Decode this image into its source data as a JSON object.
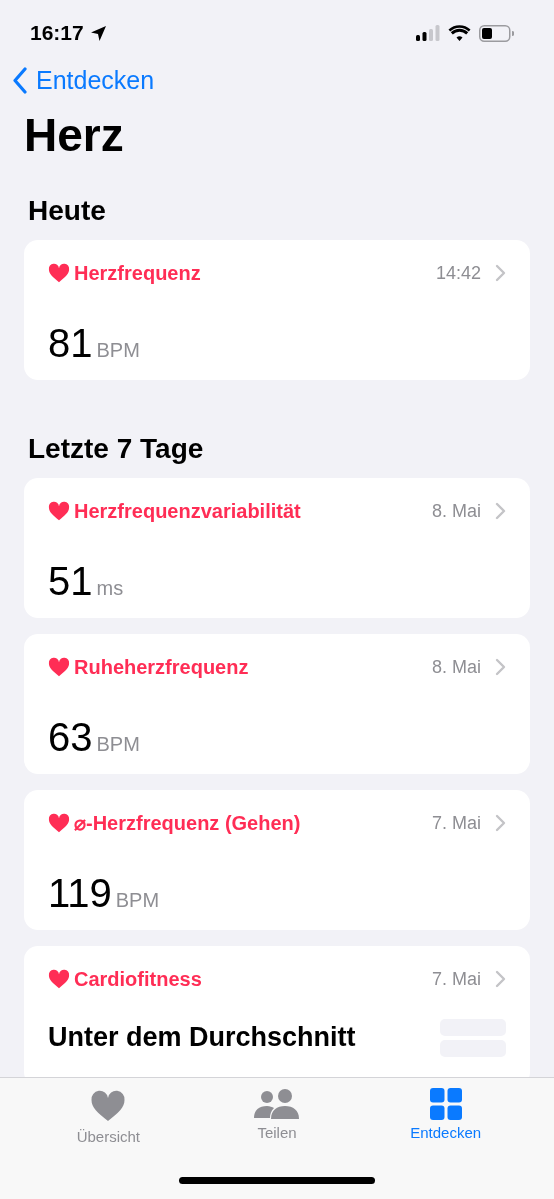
{
  "status_bar": {
    "time": "16:17"
  },
  "nav": {
    "back": "Entdecken"
  },
  "title": "Herz",
  "sections": [
    {
      "title": "Heute",
      "cards": [
        {
          "kind": "metric",
          "label": "Herzfrequenz",
          "date": "14:42",
          "value": "81",
          "unit": "BPM"
        }
      ]
    },
    {
      "title": "Letzte 7 Tage",
      "cards": [
        {
          "kind": "metric",
          "label": "Herzfrequenzvariabilität",
          "date": "8. Mai",
          "value": "51",
          "unit": "ms"
        },
        {
          "kind": "metric",
          "label": "Ruheherzfrequenz",
          "date": "8. Mai",
          "value": "63",
          "unit": "BPM"
        },
        {
          "kind": "metric",
          "label": "⌀-Herzfrequenz (Gehen)",
          "date": "7. Mai",
          "value": "119",
          "unit": "BPM"
        },
        {
          "kind": "classification",
          "label": "Cardiofitness",
          "date": "7. Mai",
          "value": "Unter dem Durchschnitt"
        }
      ]
    }
  ],
  "tabs": [
    {
      "label": "Übersicht",
      "selected": false
    },
    {
      "label": "Teilen",
      "selected": false
    },
    {
      "label": "Entdecken",
      "selected": true
    }
  ]
}
